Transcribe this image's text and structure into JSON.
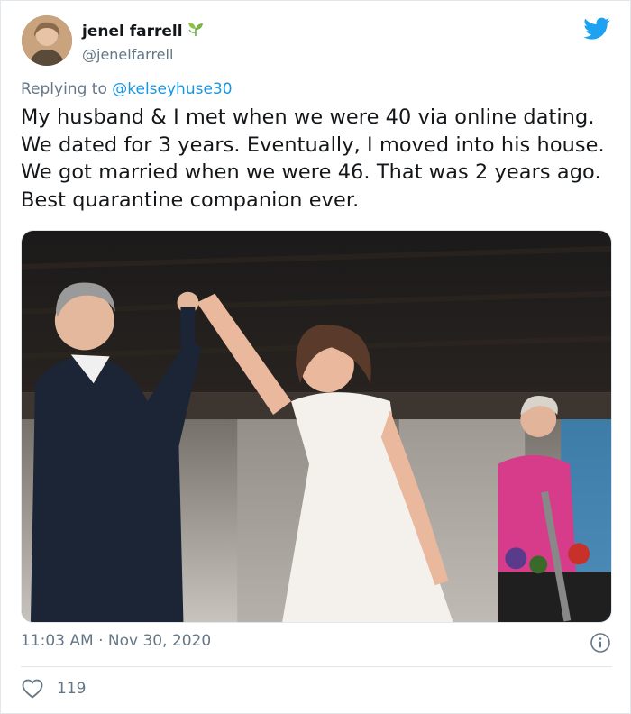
{
  "author": {
    "display_name": "jenel farrell",
    "handle": "@jenelfarrell",
    "name_emoji_icon": "seedling-icon"
  },
  "reply": {
    "prefix": "Replying to",
    "to_handle": "@kelseyhuse30"
  },
  "tweet": {
    "text": "My husband & I met when we were 40 via online dating. We dated for 3 years. Eventually, I moved into his house. We got married when we were 46. That was 2 years ago. Best quarantine companion ever."
  },
  "meta": {
    "timestamp": "11:03 AM · Nov 30, 2020",
    "info_icon": "info-icon"
  },
  "engagement": {
    "likes": "119",
    "like_icon": "heart-icon"
  },
  "colors": {
    "twitter_blue": "#1da1f2",
    "link": "#1b95e0",
    "secondary_text": "#657786",
    "divider": "#e1e8ed"
  }
}
